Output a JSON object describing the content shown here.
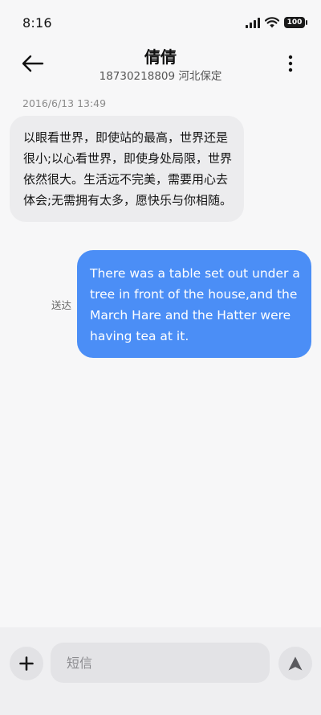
{
  "status_bar": {
    "time": "8:16",
    "battery": "100"
  },
  "header": {
    "contact_name": "倩倩",
    "contact_sub": "18730218809 河北保定"
  },
  "conversation": {
    "timestamp": "2016/6/13 13:49",
    "incoming_text": "以眼看世界，即使站的最高，世界还是很小;以心看世界，即使身处局限，世界依然很大。生活远不完美，需要用心去体会;无需拥有太多，愿快乐与你相随。",
    "outgoing_text": "There was a table set out under a tree in front of the house,and the March Hare and the Hatter were having tea at it.",
    "delivery_status": "送达"
  },
  "composer": {
    "placeholder": "短信"
  },
  "colors": {
    "outgoing_bubble": "#4b8ef6",
    "incoming_bubble": "#ececee",
    "background": "#f7f7f8"
  },
  "icons": {
    "back": "arrow-left-icon",
    "more": "more-vertical-icon",
    "add": "plus-icon",
    "send": "send-icon",
    "signal": "signal-icon",
    "wifi": "wifi-icon",
    "battery": "battery-icon"
  }
}
